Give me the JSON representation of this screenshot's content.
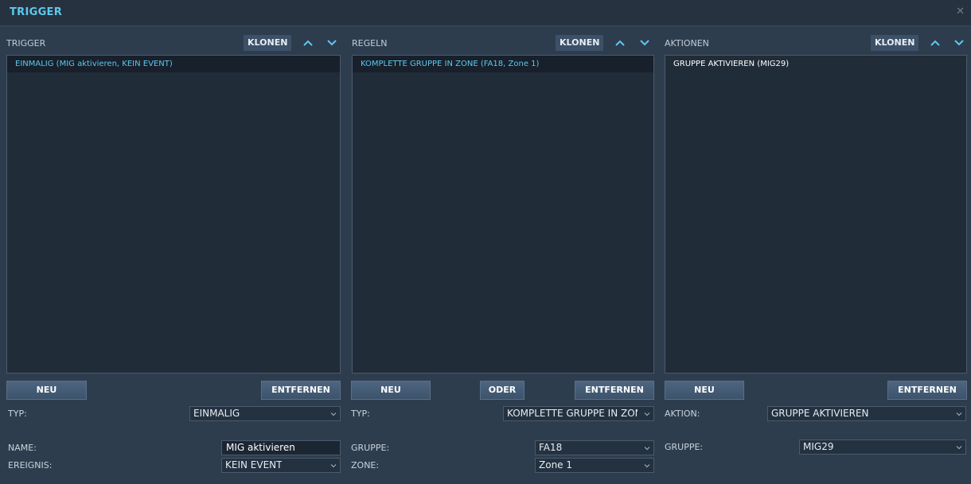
{
  "window": {
    "title": "TRIGGER",
    "close_icon": "close-icon"
  },
  "colors": {
    "accent": "#5ec8ee",
    "background": "#2e3d4e",
    "list_bg": "#212c39",
    "button": "#4d6580"
  },
  "triggers": {
    "header": "TRIGGER",
    "clone_label": "KLONEN",
    "items": [
      {
        "label": "EINMALIG (MIG aktivieren, KEIN EVENT)",
        "selected": true
      }
    ],
    "new_label": "NEU",
    "remove_label": "ENTFERNEN",
    "type": {
      "label": "TYP:",
      "value": "EINMALIG"
    },
    "name": {
      "label": "NAME:",
      "value": "MIG aktivieren"
    },
    "event": {
      "label": "EREIGNIS:",
      "value": "KEIN EVENT"
    }
  },
  "rules": {
    "header": "REGELN",
    "clone_label": "KLONEN",
    "items": [
      {
        "label": "KOMPLETTE GRUPPE IN ZONE (FA18, Zone 1)",
        "selected": true
      }
    ],
    "new_label": "NEU",
    "or_label": "ODER",
    "remove_label": "ENTFERNEN",
    "type": {
      "label": "TYP:",
      "value": "KOMPLETTE GRUPPE IN ZONE"
    },
    "group": {
      "label": "GRUPPE:",
      "value": "FA18"
    },
    "zone": {
      "label": "ZONE:",
      "value": "Zone 1"
    }
  },
  "actions": {
    "header": "AKTIONEN",
    "clone_label": "KLONEN",
    "items": [
      {
        "label": "GRUPPE AKTIVIEREN (MIG29)",
        "selected": false
      }
    ],
    "new_label": "NEU",
    "remove_label": "ENTFERNEN",
    "action": {
      "label": "AKTION:",
      "value": "GRUPPE AKTIVIEREN"
    },
    "group": {
      "label": "GRUPPE:",
      "value": "MIG29"
    }
  }
}
